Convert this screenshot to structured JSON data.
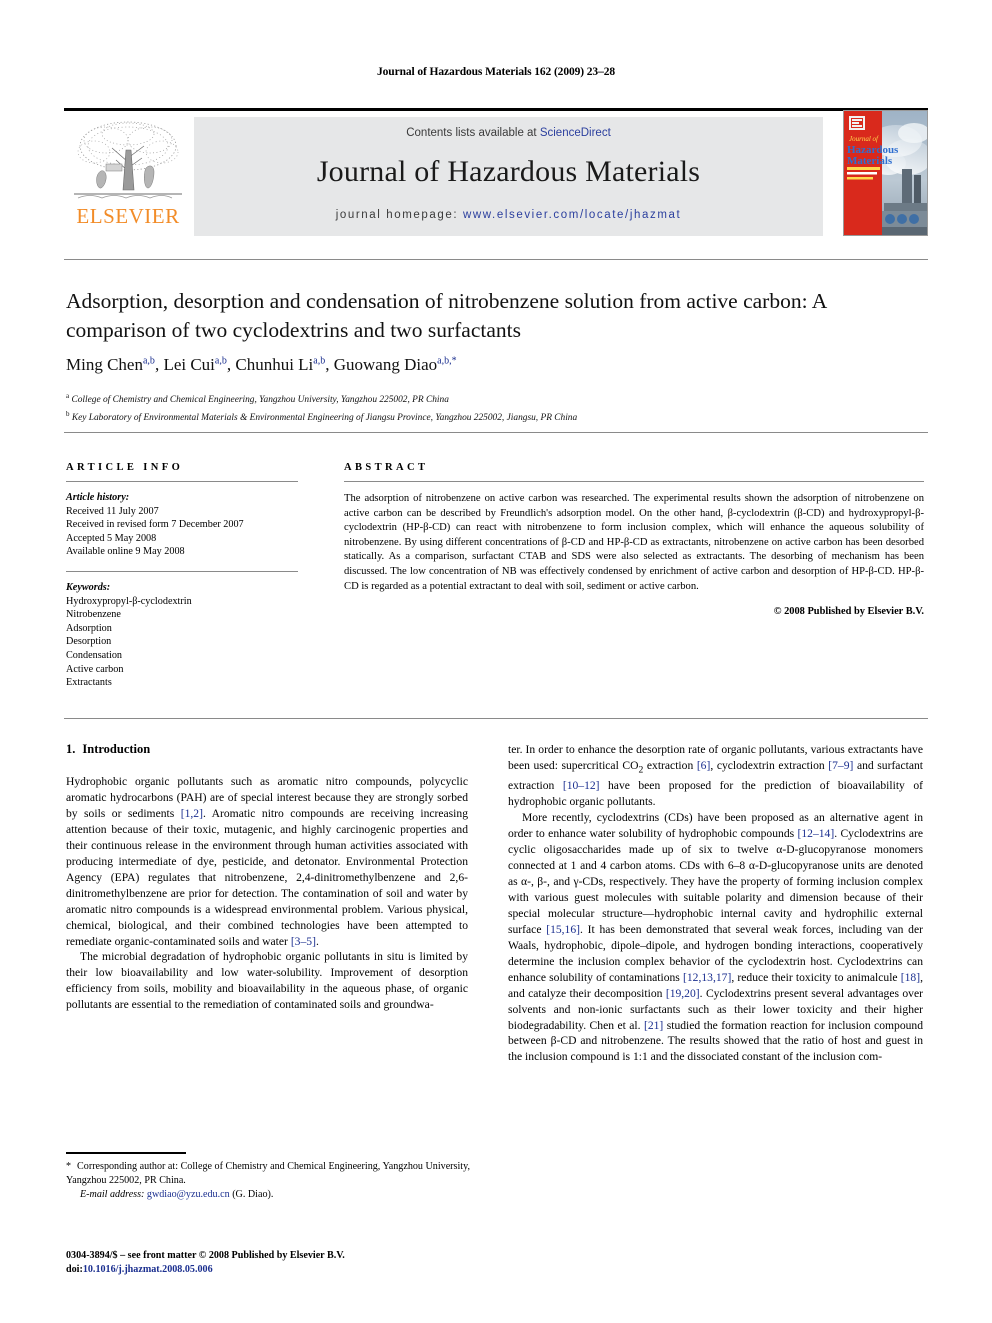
{
  "running_head": "Journal of Hazardous Materials 162 (2009) 23–28",
  "masthead": {
    "publisher_name": "ELSEVIER",
    "contents_prefix": "Contents lists available at ",
    "contents_link": "ScienceDirect",
    "journal_title": "Journal of Hazardous Materials",
    "homepage_prefix": "journal homepage: ",
    "homepage_url": "www.elsevier.com/locate/jhazmat",
    "cover_title_line1": "Journal of",
    "cover_title_line2": "Hazardous",
    "cover_title_line3": "Materials"
  },
  "article": {
    "title": "Adsorption, desorption and condensation of nitrobenzene solution from active carbon: A comparison of two cyclodextrins and two surfactants",
    "authors_html": "Ming Chen<sup>a,b</sup>, Lei Cui<sup>a,b</sup>, Chunhui Li<sup>a,b</sup>, Guowang Diao<sup>a,b,*</sup>",
    "affiliation_a": "College of Chemistry and Chemical Engineering, Yangzhou University, Yangzhou 225002, PR China",
    "affiliation_b": "Key Laboratory of Environmental Materials & Environmental Engineering of Jiangsu Province, Yangzhou 225002, Jiangsu, PR China"
  },
  "info": {
    "heading": "ARTICLE INFO",
    "history_label": "Article history:",
    "history": [
      "Received 11 July 2007",
      "Received in revised form 7 December 2007",
      "Accepted 5 May 2008",
      "Available online 9 May 2008"
    ],
    "keywords_label": "Keywords:",
    "keywords": [
      "Hydroxypropyl-β-cyclodextrin",
      "Nitrobenzene",
      "Adsorption",
      "Desorption",
      "Condensation",
      "Active carbon",
      "Extractants"
    ]
  },
  "abstract": {
    "heading": "ABSTRACT",
    "text": "The adsorption of nitrobenzene on active carbon was researched. The experimental results shown the adsorption of nitrobenzene on active carbon can be described by Freundlich's adsorption model. On the other hand, β-cyclodextrin (β-CD) and hydroxypropyl-β-cyclodextrin (HP-β-CD) can react with nitrobenzene to form inclusion complex, which will enhance the aqueous solubility of nitrobenzene. By using different concentrations of β-CD and HP-β-CD as extractants, nitrobenzene on active carbon has been desorbed statically. As a comparison, surfactant CTAB and SDS were also selected as extractants. The desorbing of mechanism has been discussed. The low concentration of NB was effectively condensed by enrichment of active carbon and desorption of HP-β-CD. HP-β-CD is regarded as a potential extractant to deal with soil, sediment or active carbon.",
    "copyright": "© 2008 Published by Elsevier B.V."
  },
  "body": {
    "section_number": "1.",
    "section_title": "Introduction",
    "left_paragraphs": [
      "Hydrophobic organic pollutants such as aromatic nitro compounds, polycyclic aromatic hydrocarbons (PAH) are of special interest because they are strongly sorbed by soils or sediments [1,2]. Aromatic nitro compounds are receiving increasing attention because of their toxic, mutagenic, and highly carcinogenic properties and their continuous release in the environment through human activities associated with producing intermediate of dye, pesticide, and detonator. Environmental Protection Agency (EPA) regulates that nitrobenzene, 2,4-dinitromethylbenzene and 2,6-dinitromethylbenzene are prior for detection. The contamination of soil and water by aromatic nitro compounds is a widespread environmental problem. Various physical, chemical, biological, and their combined technologies have been attempted to remediate organic-contaminated soils and water [3–5].",
      "The microbial degradation of hydrophobic organic pollutants in situ is limited by their low bioavailability and low water-solubility. Improvement of desorption efficiency from soils, mobility and bioavailability in the aqueous phase, of organic pollutants are essential to the remediation of contaminated soils and groundwa-"
    ],
    "right_paragraphs": [
      "ter. In order to enhance the desorption rate of organic pollutants, various extractants have been used: supercritical CO2 extraction [6], cyclodextrin extraction [7–9] and surfactant extraction [10–12] have been proposed for the prediction of bioavailability of hydrophobic organic pollutants.",
      "More recently, cyclodextrins (CDs) have been proposed as an alternative agent in order to enhance water solubility of hydrophobic compounds [12–14]. Cyclodextrins are cyclic oligosaccharides made up of six to twelve α-D-glucopyranose monomers connected at 1 and 4 carbon atoms. CDs with 6–8 α-D-glucopyranose units are denoted as α-, β-, and γ-CDs, respectively. They have the property of forming inclusion complex with various guest molecules with suitable polarity and dimension because of their special molecular structure—hydrophobic internal cavity and hydrophilic external surface [15,16]. It has been demonstrated that several weak forces, including van der Waals, hydrophobic, dipole–dipole, and hydrogen bonding interactions, cooperatively determine the inclusion complex behavior of the cyclodextrin host. Cyclodextrins can enhance solubility of contaminations [12,13,17], reduce their toxicity to animalcule [18], and catalyze their decomposition [19,20]. Cyclodextrins present several advantages over solvents and non-ionic surfactants such as their lower toxicity and their higher biodegradability. Chen et al. [21] studied the formation reaction for inclusion compound between β-CD and nitrobenzene. The results showed that the ratio of host and guest in the inclusion compound is 1:1 and the dissociated constant of the inclusion com-"
    ]
  },
  "footnote": {
    "star": "*",
    "corresponding": "Corresponding author at: College of Chemistry and Chemical Engineering, Yangzhou University, Yangzhou 225002, PR China.",
    "email_label": "E-mail address:",
    "email": "gwdiao@yzu.edu.cn",
    "email_attrib": "(G. Diao)."
  },
  "footer": {
    "issn_line": "0304-3894/$ – see front matter © 2008 Published by Elsevier B.V.",
    "doi_label": "doi:",
    "doi": "10.1016/j.jhazmat.2008.05.006"
  }
}
